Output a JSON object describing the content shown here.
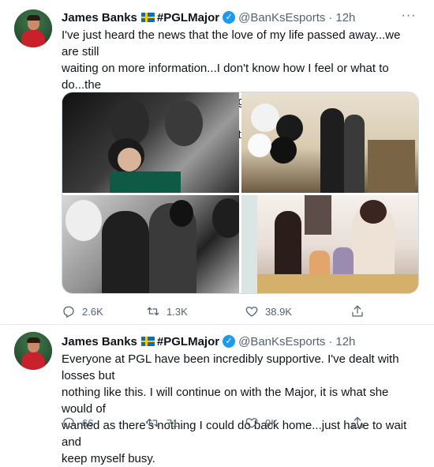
{
  "tweets": [
    {
      "author_name": "James Banks",
      "author_tag": "#PGLMajor",
      "handle": "@BanKsEsports",
      "separator": "·",
      "time": "12h",
      "text": "I've just heard the news that the love of my life passed away...we are still\nwaiting on more information...I don't know how I feel or what to do...the\npain is unbearable. I will never forget the memories we made! She was far\ntoo young for this & had so much to give 😭😭😭💔💔💔!",
      "replies": "2.6K",
      "retweets": "1.3K",
      "likes": "38.9K",
      "media_count": 4
    },
    {
      "author_name": "James Banks",
      "author_tag": "#PGLMajor",
      "handle": "@BanKsEsports",
      "separator": "·",
      "time": "12h",
      "text": "Everyone at PGL have been incredibly supportive. I've dealt with losses but\nnothing like this. I will continue on with the Major, it is what she would of\nwanted as there's nothing I could do back home...just have to wait and\nkeep myself busy.",
      "replies": "66",
      "retweets": "71",
      "likes": "9K"
    }
  ],
  "icons": {
    "verified": "verified-badge-icon",
    "flag": "sweden-flag-icon",
    "more": "more-horizontal-icon",
    "reply": "reply-icon",
    "retweet": "retweet-icon",
    "like": "heart-icon",
    "share": "share-icon"
  },
  "colors": {
    "accent": "#1d9bf0",
    "text": "#0f1419",
    "secondary": "#536471",
    "divider": "#e6ecf0"
  }
}
